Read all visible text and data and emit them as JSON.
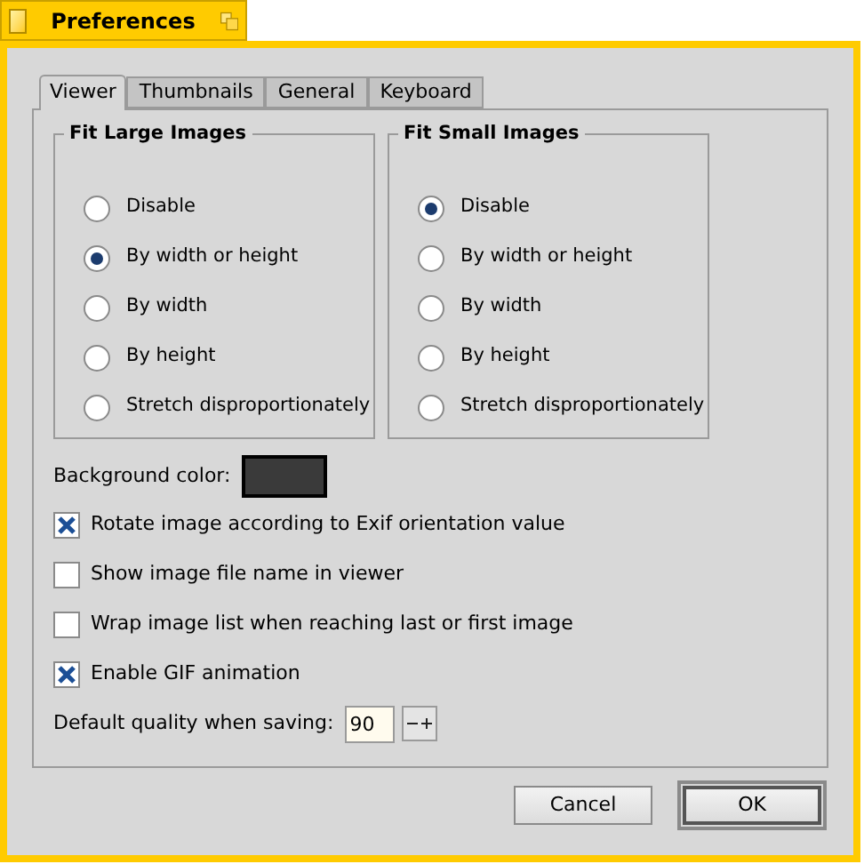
{
  "window": {
    "title": "Preferences"
  },
  "tabs": [
    {
      "label": "Viewer",
      "selected": true
    },
    {
      "label": "Thumbnails",
      "selected": false
    },
    {
      "label": "General",
      "selected": false
    },
    {
      "label": "Keyboard",
      "selected": false
    }
  ],
  "groups": [
    {
      "title": "Fit Large Images",
      "options": [
        {
          "label": "Disable",
          "selected": false
        },
        {
          "label": "By width or height",
          "selected": true
        },
        {
          "label": "By width",
          "selected": false
        },
        {
          "label": "By height",
          "selected": false
        },
        {
          "label": "Stretch disproportionately",
          "selected": false
        }
      ]
    },
    {
      "title": "Fit Small Images",
      "options": [
        {
          "label": "Disable",
          "selected": true
        },
        {
          "label": "By width or height",
          "selected": false
        },
        {
          "label": "By width",
          "selected": false
        },
        {
          "label": "By height",
          "selected": false
        },
        {
          "label": "Stretch disproportionately",
          "selected": false
        }
      ]
    }
  ],
  "background_color": {
    "label": "Background color:",
    "color": "#3a3a3a"
  },
  "checkboxes": [
    {
      "label": "Rotate image according to Exif orientation value",
      "checked": true
    },
    {
      "label": "Show image file name in viewer",
      "checked": false
    },
    {
      "label": "Wrap image list when reaching last or first image",
      "checked": false
    },
    {
      "label": "Enable GIF animation",
      "checked": true
    }
  ],
  "quality": {
    "label": "Default quality when saving:",
    "value": "90"
  },
  "buttons": [
    {
      "label": "Cancel",
      "default": false
    },
    {
      "label": "OK",
      "default": true
    }
  ]
}
